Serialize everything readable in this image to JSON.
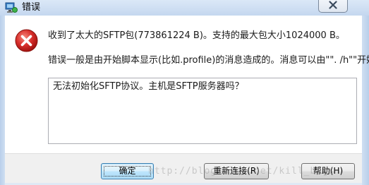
{
  "window": {
    "title": "错误",
    "close_label": "关闭"
  },
  "message": {
    "line1": "收到了太大的SFTP包(773861224 B)。支持的最大包大小1024000 B。",
    "line2": "错误一般是由开始脚本显示(比如.profile)的消息造成的。消息可以由\"\". /h\"\"开始。"
  },
  "detail": {
    "text": "无法初始化SFTP协议。主机是SFTP服务器吗？"
  },
  "buttons": {
    "ok": "确定",
    "reconnect": "重新连接(R)",
    "help": "帮助(H)"
  },
  "watermark": "http://blog.csdn.net/kill_bugs",
  "colors": {
    "error_red": "#d9302c",
    "default_button_border": "#3c7fb1"
  },
  "icons": {
    "title": "app-computer-icon",
    "error": "error-x-icon",
    "close": "close-icon"
  }
}
